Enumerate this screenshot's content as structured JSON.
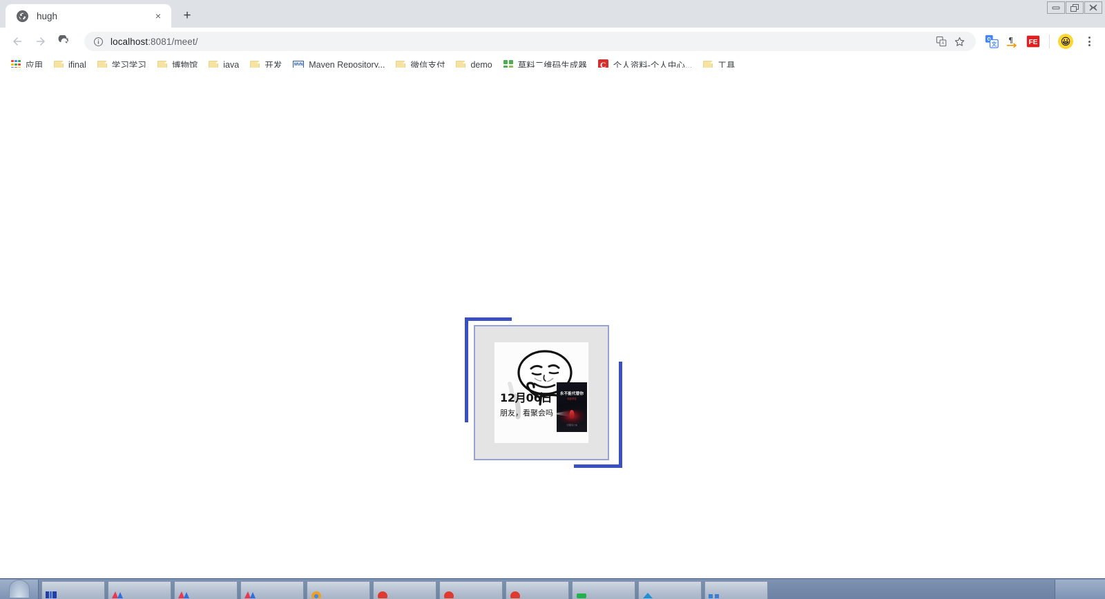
{
  "window": {
    "controls": [
      {
        "name": "minimize-button",
        "glyph": "—"
      },
      {
        "name": "restore-button",
        "glyph": "❐"
      },
      {
        "name": "close-button",
        "glyph": "✕"
      }
    ]
  },
  "tabs": [
    {
      "title": "hugh",
      "favicon": "globe-icon",
      "close_label": "×"
    }
  ],
  "newtab_label": "+",
  "toolbar": {
    "back_label": "←",
    "forward_label": "→",
    "reload_label": "↻",
    "info_label": "ⓘ",
    "url_host": "localhost",
    "url_rest": ":8081/meet/",
    "url_full": "localhost:8081/meet/",
    "translate_label": "⛶",
    "bookmark_star_label": "☆",
    "extensions": [
      {
        "name": "google-translate-extension-icon",
        "label": "G"
      },
      {
        "name": "pilcrow-extension-icon",
        "label": "¶"
      },
      {
        "name": "fe-extension-icon",
        "label": "FE"
      }
    ],
    "avatar_label": "😀",
    "menu_label": "⋮"
  },
  "bookmarks": [
    {
      "label": "应用",
      "icon": "apps-grid-icon"
    },
    {
      "label": "jfinal",
      "icon": "folder-icon"
    },
    {
      "label": "学习学习",
      "icon": "folder-icon"
    },
    {
      "label": "博物馆",
      "icon": "folder-icon"
    },
    {
      "label": "java",
      "icon": "folder-icon"
    },
    {
      "label": "开发",
      "icon": "folder-icon"
    },
    {
      "label": "Maven Repository...",
      "icon": "maven-icon"
    },
    {
      "label": "微信支付",
      "icon": "folder-icon"
    },
    {
      "label": "demo",
      "icon": "folder-icon"
    },
    {
      "label": "草料二维码生成器",
      "icon": "qr-code-icon"
    },
    {
      "label": "个人资料-个人中心...",
      "icon": "c-red-icon"
    },
    {
      "label": "工具",
      "icon": "folder-icon"
    }
  ],
  "page": {
    "card": {
      "date": "12月06日",
      "caption": "朋友，看聚会吗",
      "poster": {
        "title": "永不能代替你",
        "subtitle": "电影预告",
        "footer": "全国影院上映"
      },
      "colors": {
        "accent_dark": "#3b50c0",
        "accent_light": "#97a3d6",
        "card_bg": "#e4e4e4"
      }
    }
  },
  "taskbar": {
    "start_label": "",
    "items": [
      {
        "name": "taskbar-item-1"
      },
      {
        "name": "taskbar-item-2"
      },
      {
        "name": "taskbar-item-3"
      },
      {
        "name": "taskbar-item-4"
      },
      {
        "name": "taskbar-item-5"
      },
      {
        "name": "taskbar-item-6"
      },
      {
        "name": "taskbar-item-7"
      },
      {
        "name": "taskbar-item-8"
      },
      {
        "name": "taskbar-item-9"
      },
      {
        "name": "taskbar-item-10"
      },
      {
        "name": "taskbar-item-11"
      }
    ]
  }
}
